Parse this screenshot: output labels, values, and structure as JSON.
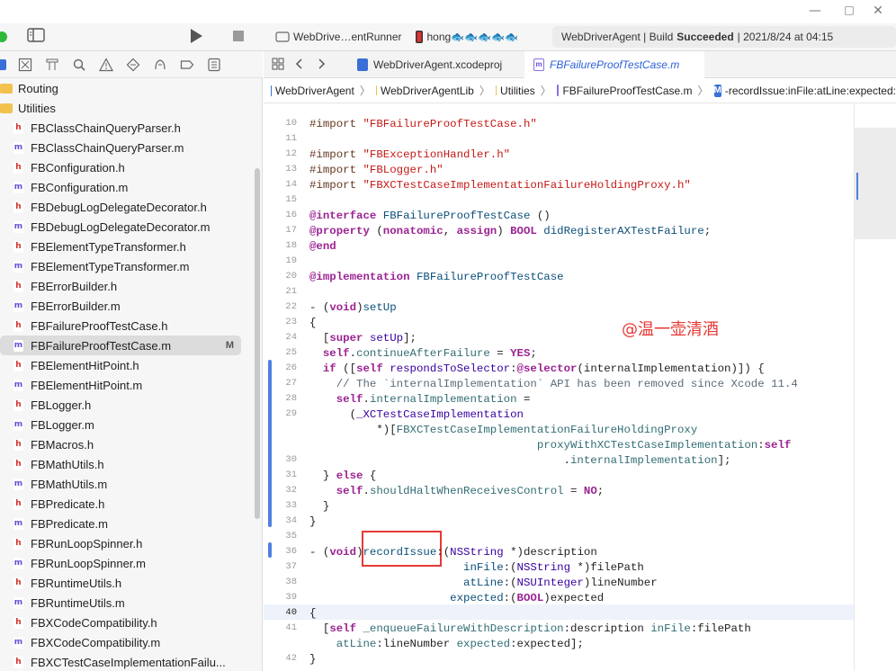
{
  "window": {
    "controls": [
      "—",
      "□",
      "✕"
    ]
  },
  "toolbar": {
    "scheme": "WebDrive…entRunner",
    "device": "hong🐟🐟🐟🐟🐟",
    "status_prefix": "WebDriverAgent | Build",
    "status_strong": "Succeeded",
    "status_suffix": "| 2021/8/24 at 04:15"
  },
  "tabs": [
    {
      "label": "WebDriverAgent.xcodeproj",
      "icon": "xcodeproj-icon"
    },
    {
      "label": "FBFailureProofTestCase.m",
      "icon": "objc-m-file-icon"
    }
  ],
  "jumpbar": {
    "items": [
      "WebDriverAgent",
      "WebDriverAgentLib",
      "Utilities",
      "FBFailureProofTestCase.m",
      "-recordIssue:inFile:atLine:expected:"
    ],
    "sep": "〉",
    "method_badge": "M"
  },
  "sidebar": {
    "items": [
      {
        "type": "folder",
        "label": "Routing"
      },
      {
        "type": "folder",
        "label": "Utilities"
      },
      {
        "type": "h",
        "label": "FBClassChainQueryParser.h"
      },
      {
        "type": "m",
        "label": "FBClassChainQueryParser.m"
      },
      {
        "type": "h",
        "label": "FBConfiguration.h"
      },
      {
        "type": "m",
        "label": "FBConfiguration.m"
      },
      {
        "type": "h",
        "label": "FBDebugLogDelegateDecorator.h"
      },
      {
        "type": "m",
        "label": "FBDebugLogDelegateDecorator.m"
      },
      {
        "type": "h",
        "label": "FBElementTypeTransformer.h"
      },
      {
        "type": "m",
        "label": "FBElementTypeTransformer.m"
      },
      {
        "type": "h",
        "label": "FBErrorBuilder.h"
      },
      {
        "type": "m",
        "label": "FBErrorBuilder.m"
      },
      {
        "type": "h",
        "label": "FBFailureProofTestCase.h"
      },
      {
        "type": "m",
        "label": "FBFailureProofTestCase.m",
        "selected": true,
        "status": "M"
      },
      {
        "type": "h",
        "label": "FBElementHitPoint.h"
      },
      {
        "type": "m",
        "label": "FBElementHitPoint.m"
      },
      {
        "type": "h",
        "label": "FBLogger.h"
      },
      {
        "type": "m",
        "label": "FBLogger.m"
      },
      {
        "type": "h",
        "label": "FBMacros.h"
      },
      {
        "type": "h",
        "label": "FBMathUtils.h"
      },
      {
        "type": "m",
        "label": "FBMathUtils.m"
      },
      {
        "type": "h",
        "label": "FBPredicate.h"
      },
      {
        "type": "m",
        "label": "FBPredicate.m"
      },
      {
        "type": "h",
        "label": "FBRunLoopSpinner.h"
      },
      {
        "type": "m",
        "label": "FBRunLoopSpinner.m"
      },
      {
        "type": "h",
        "label": "FBRuntimeUtils.h"
      },
      {
        "type": "m",
        "label": "FBRuntimeUtils.m"
      },
      {
        "type": "h",
        "label": "FBXCodeCompatibility.h"
      },
      {
        "type": "m",
        "label": "FBXCodeCompatibility.m"
      },
      {
        "type": "h",
        "label": "FBXCTestCaseImplementationFailu..."
      }
    ]
  },
  "editor": {
    "current_line": 40,
    "watermark": "@温一壶清酒",
    "lines": [
      {
        "n": "10",
        "html": "<span class=\"mc\">#import</span> <span class=\"str\">\"FBFailureProofTestCase.h\"</span>"
      },
      {
        "n": "11",
        "html": ""
      },
      {
        "n": "12",
        "html": "<span class=\"mc\">#import</span> <span class=\"str\">\"FBExceptionHandler.h\"</span>"
      },
      {
        "n": "13",
        "html": "<span class=\"mc\">#import</span> <span class=\"str\">\"FBLogger.h\"</span>"
      },
      {
        "n": "14",
        "html": "<span class=\"mc\">#import</span> <span class=\"str\">\"FBXCTestCaseImplementationFailureHoldingProxy.h\"</span>"
      },
      {
        "n": "15",
        "html": ""
      },
      {
        "n": "16",
        "html": "<span class=\"kw\">@interface</span> <span class=\"ty\">FBFailureProofTestCase</span> ()"
      },
      {
        "n": "17",
        "html": "<span class=\"kw\">@property</span> (<span class=\"kw\">nonatomic</span>, <span class=\"kw\">assign</span>) <span class=\"kw\">BOOL</span> <span class=\"ty\">didRegisterAXTestFailure</span>;"
      },
      {
        "n": "18",
        "html": "<span class=\"kw\">@end</span>"
      },
      {
        "n": "19",
        "html": ""
      },
      {
        "n": "20",
        "html": "<span class=\"kw\">@implementation</span> <span class=\"ty\">FBFailureProofTestCase</span>"
      },
      {
        "n": "21",
        "html": ""
      },
      {
        "n": "22",
        "html": "- (<span class=\"kw\">void</span>)<span class=\"ty\">setUp</span>"
      },
      {
        "n": "23",
        "html": "{"
      },
      {
        "n": "24",
        "html": "  [<span class=\"kw\">super</span> <span class=\"pm\">setUp</span>];"
      },
      {
        "n": "25",
        "html": "  <span class=\"kw\">self</span>.<span class=\"fn\">continueAfterFailure</span> = <span class=\"kw\">YES</span>;"
      },
      {
        "n": "26",
        "html": "  <span class=\"kw\">if</span> ([<span class=\"kw\">self</span> <span class=\"pm\">respondsToSelector</span>:<span class=\"kw\">@selector</span>(internalImplementation)]) {"
      },
      {
        "n": "27",
        "html": "    <span class=\"cm\">// The `internalImplementation` API has been removed since Xcode 11.4</span>"
      },
      {
        "n": "28",
        "html": "    <span class=\"kw\">self</span>.<span class=\"fn\">internalImplementation</span> ="
      },
      {
        "n": "29",
        "html": "      (<span class=\"pm\">_XCTestCaseImplementation</span>\n          *)[<span class=\"fn\">FBXCTestCaseImplementationFailureHoldingProxy</span>"
      },
      {
        "n": "30",
        "html": "                                  <span class=\"fn\">proxyWithXCTestCaseImplementation</span>:<span class=\"kw\">self</span>\n                                      .<span class=\"fn\">internalImplementation</span>];"
      },
      {
        "n": "31",
        "html": "  } <span class=\"kw\">else</span> {"
      },
      {
        "n": "32",
        "html": "    <span class=\"kw\">self</span>.<span class=\"fn\">shouldHaltWhenReceivesControl</span> = <span class=\"kw\">NO</span>;"
      },
      {
        "n": "33",
        "html": "  }"
      },
      {
        "n": "34",
        "html": "}"
      },
      {
        "n": "35",
        "html": ""
      },
      {
        "n": "36",
        "html": "- (<span class=\"kw\">void</span>)<span class=\"ty\">recordIssue</span>:(<span class=\"pm\">NSString</span> *)description"
      },
      {
        "n": "37",
        "html": "                       <span class=\"ty\">inFile</span>:(<span class=\"pm\">NSString</span> *)filePath"
      },
      {
        "n": "38",
        "html": "                       <span class=\"ty\">atLine</span>:(<span class=\"pm\">NSUInteger</span>)lineNumber"
      },
      {
        "n": "39",
        "html": "                     <span class=\"ty\">expected</span>:(<span class=\"kw\">BOOL</span>)expected"
      },
      {
        "n": "40",
        "html": "{"
      },
      {
        "n": "41",
        "html": "  [<span class=\"kw\">self</span> <span class=\"fn\">_enqueueFailureWithDescription</span>:description <span class=\"fn\">inFile</span>:filePath\n    <span class=\"fn\">atLine</span>:lineNumber <span class=\"fn\">expected</span>:expected];"
      },
      {
        "n": "42",
        "html": "}"
      }
    ]
  }
}
